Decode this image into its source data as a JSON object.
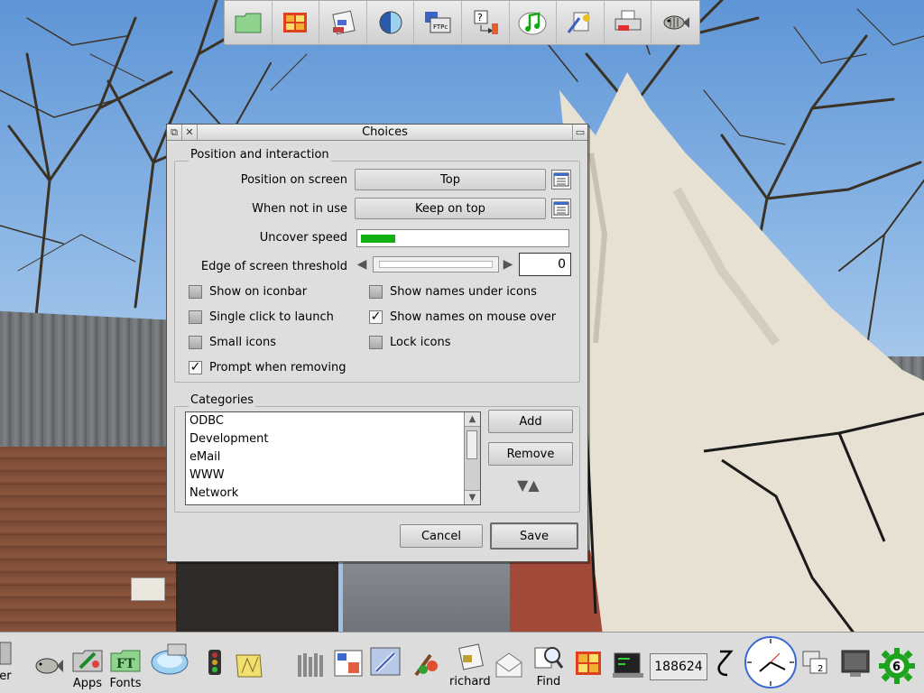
{
  "top_iconbar": {
    "items": [
      {
        "name": "folder-icon"
      },
      {
        "name": "puzzle-kit-icon"
      },
      {
        "name": "news-icon"
      },
      {
        "name": "globe-icon"
      },
      {
        "name": "ftpc-icon",
        "label": "FTPc"
      },
      {
        "name": "help-icon"
      },
      {
        "name": "music-icon"
      },
      {
        "name": "toolbox-icon"
      },
      {
        "name": "printer-icon"
      },
      {
        "name": "fish-icon"
      }
    ]
  },
  "window": {
    "title": "Choices",
    "position_group": {
      "label": "Position and interaction",
      "position_on_screen": {
        "label": "Position on screen",
        "value": "Top"
      },
      "when_not_in_use": {
        "label": "When not in use",
        "value": "Keep on top"
      },
      "uncover_speed": {
        "label": "Uncover speed",
        "level": 0.17
      },
      "edge_threshold": {
        "label": "Edge of screen threshold",
        "value": "0"
      },
      "options": [
        {
          "label": "Show on iconbar",
          "checked": false
        },
        {
          "label": "Show names under icons",
          "checked": false
        },
        {
          "label": "Single click to launch",
          "checked": false
        },
        {
          "label": "Show names on mouse over",
          "checked": true
        },
        {
          "label": "Small icons",
          "checked": false
        },
        {
          "label": "Lock icons",
          "checked": false
        },
        {
          "label": "Prompt when removing",
          "checked": true
        }
      ]
    },
    "categories_group": {
      "label": "Categories",
      "items": [
        "ODBC",
        "Development",
        "eMail",
        "WWW",
        "Network"
      ],
      "add_label": "Add",
      "remove_label": "Remove"
    },
    "cancel_label": "Cancel",
    "save_label": "Save"
  },
  "iconbar": {
    "left_partial_label": "aster",
    "apps_label": "Apps",
    "fonts_label": "Fonts",
    "fonts_icon_text": "FT",
    "richard_label": "richard",
    "find_label": "Find",
    "memory_value": "188624",
    "task_badge": "6"
  },
  "colors": {
    "speed_fill": "#10b010",
    "ftp_green": "#1a9a2e",
    "task_gear": "#1da31d"
  }
}
